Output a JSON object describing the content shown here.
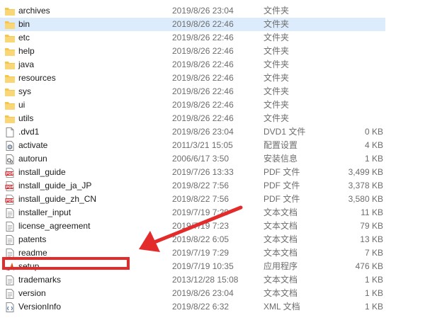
{
  "files": [
    {
      "name": "archives",
      "date": "2019/8/26 23:04",
      "type": "文件夹",
      "size": "",
      "icon": "folder-icon"
    },
    {
      "name": "bin",
      "date": "2019/8/26 22:46",
      "type": "文件夹",
      "size": "",
      "icon": "folder-icon",
      "selected": true
    },
    {
      "name": "etc",
      "date": "2019/8/26 22:46",
      "type": "文件夹",
      "size": "",
      "icon": "folder-icon"
    },
    {
      "name": "help",
      "date": "2019/8/26 22:46",
      "type": "文件夹",
      "size": "",
      "icon": "folder-icon"
    },
    {
      "name": "java",
      "date": "2019/8/26 22:46",
      "type": "文件夹",
      "size": "",
      "icon": "folder-icon"
    },
    {
      "name": "resources",
      "date": "2019/8/26 22:46",
      "type": "文件夹",
      "size": "",
      "icon": "folder-icon"
    },
    {
      "name": "sys",
      "date": "2019/8/26 22:46",
      "type": "文件夹",
      "size": "",
      "icon": "folder-icon"
    },
    {
      "name": "ui",
      "date": "2019/8/26 22:46",
      "type": "文件夹",
      "size": "",
      "icon": "folder-icon"
    },
    {
      "name": "utils",
      "date": "2019/8/26 22:46",
      "type": "文件夹",
      "size": "",
      "icon": "folder-icon"
    },
    {
      "name": ".dvd1",
      "date": "2019/8/26 23:04",
      "type": "DVD1 文件",
      "size": "0 KB",
      "icon": "file-icon"
    },
    {
      "name": "activate",
      "date": "2011/3/21 15:05",
      "type": "配置设置",
      "size": "4 KB",
      "icon": "config-file-icon"
    },
    {
      "name": "autorun",
      "date": "2006/6/17 3:50",
      "type": "安装信息",
      "size": "1 KB",
      "icon": "setup-info-icon"
    },
    {
      "name": "install_guide",
      "date": "2019/7/26 13:33",
      "type": "PDF 文件",
      "size": "3,499 KB",
      "icon": "pdf-icon"
    },
    {
      "name": "install_guide_ja_JP",
      "date": "2019/8/22 7:56",
      "type": "PDF 文件",
      "size": "3,378 KB",
      "icon": "pdf-icon"
    },
    {
      "name": "install_guide_zh_CN",
      "date": "2019/8/22 7:56",
      "type": "PDF 文件",
      "size": "3,580 KB",
      "icon": "pdf-icon"
    },
    {
      "name": "installer_input",
      "date": "2019/7/19 7:29",
      "type": "文本文档",
      "size": "11 KB",
      "icon": "text-file-icon"
    },
    {
      "name": "license_agreement",
      "date": "2019/7/19 7:23",
      "type": "文本文档",
      "size": "79 KB",
      "icon": "text-file-icon"
    },
    {
      "name": "patents",
      "date": "2019/8/22 6:05",
      "type": "文本文档",
      "size": "13 KB",
      "icon": "text-file-icon"
    },
    {
      "name": "readme",
      "date": "2019/7/19 7:29",
      "type": "文本文档",
      "size": "7 KB",
      "icon": "text-file-icon"
    },
    {
      "name": "setup",
      "date": "2019/7/19 10:35",
      "type": "应用程序",
      "size": "476 KB",
      "icon": "matlab-app-icon"
    },
    {
      "name": "trademarks",
      "date": "2013/12/28 15:08",
      "type": "文本文档",
      "size": "1 KB",
      "icon": "text-file-icon"
    },
    {
      "name": "version",
      "date": "2019/8/26 23:04",
      "type": "文本文档",
      "size": "1 KB",
      "icon": "text-file-icon"
    },
    {
      "name": "VersionInfo",
      "date": "2019/8/22 6:32",
      "type": "XML 文档",
      "size": "1 KB",
      "icon": "xml-file-icon"
    }
  ],
  "colors": {
    "folder": "#f6c54a",
    "folder_dark": "#e0a82a",
    "selection": "#dcecfc",
    "annotation": "#e42b2b",
    "pdf": "#d8232a"
  }
}
